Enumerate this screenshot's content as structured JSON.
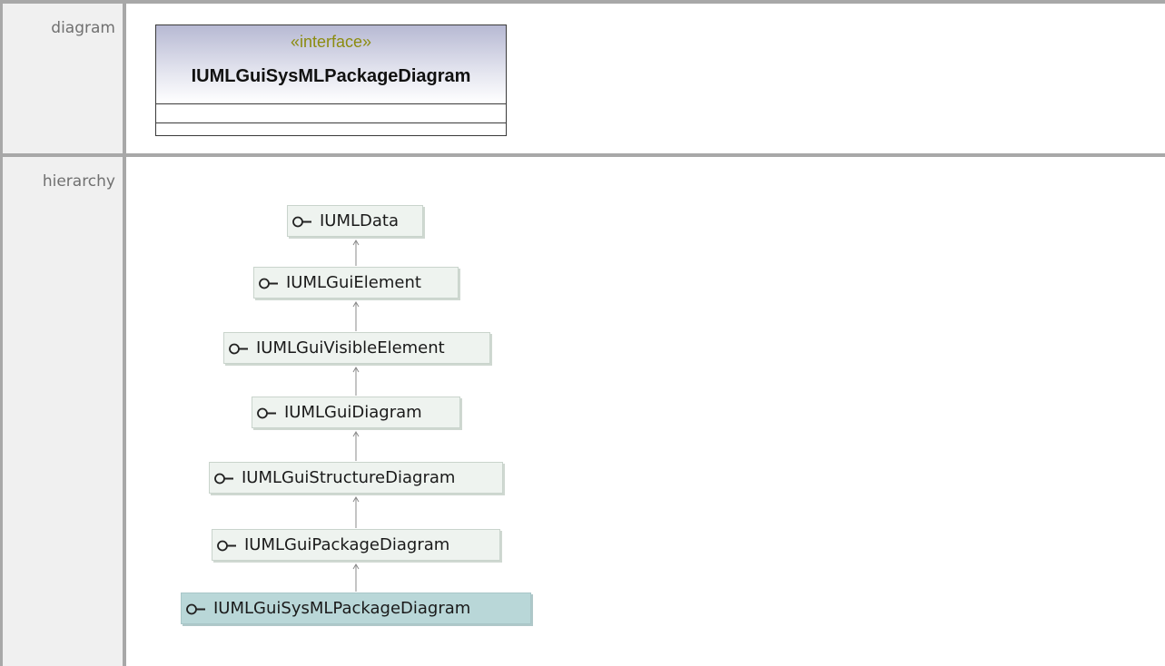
{
  "table": {
    "rows": [
      {
        "label": "diagram"
      },
      {
        "label": "hierarchy"
      }
    ]
  },
  "interface_box": {
    "stereotype": "«interface»",
    "name": "IUMLGuiSysMLPackageDiagram"
  },
  "hierarchy": {
    "nodes": [
      {
        "name": "IUMLData",
        "icon": "interface-lollipop-icon"
      },
      {
        "name": "IUMLGuiElement",
        "icon": "interface-lollipop-icon"
      },
      {
        "name": "IUMLGuiVisibleElement",
        "icon": "interface-lollipop-icon"
      },
      {
        "name": "IUMLGuiDiagram",
        "icon": "interface-lollipop-icon"
      },
      {
        "name": "IUMLGuiStructureDiagram",
        "icon": "interface-lollipop-icon"
      },
      {
        "name": "IUMLGuiPackageDiagram",
        "icon": "interface-lollipop-icon"
      },
      {
        "name": "IUMLGuiSysMLPackageDiagram",
        "icon": "interface-lollipop-icon",
        "current": true
      }
    ]
  },
  "colors": {
    "frame": "#a8a8a8",
    "label_cell": "#f0f0f0",
    "node_fill": "#eef3ef",
    "current_node_fill": "#b9d7d8",
    "stereotype_text": "#8c8c10"
  }
}
